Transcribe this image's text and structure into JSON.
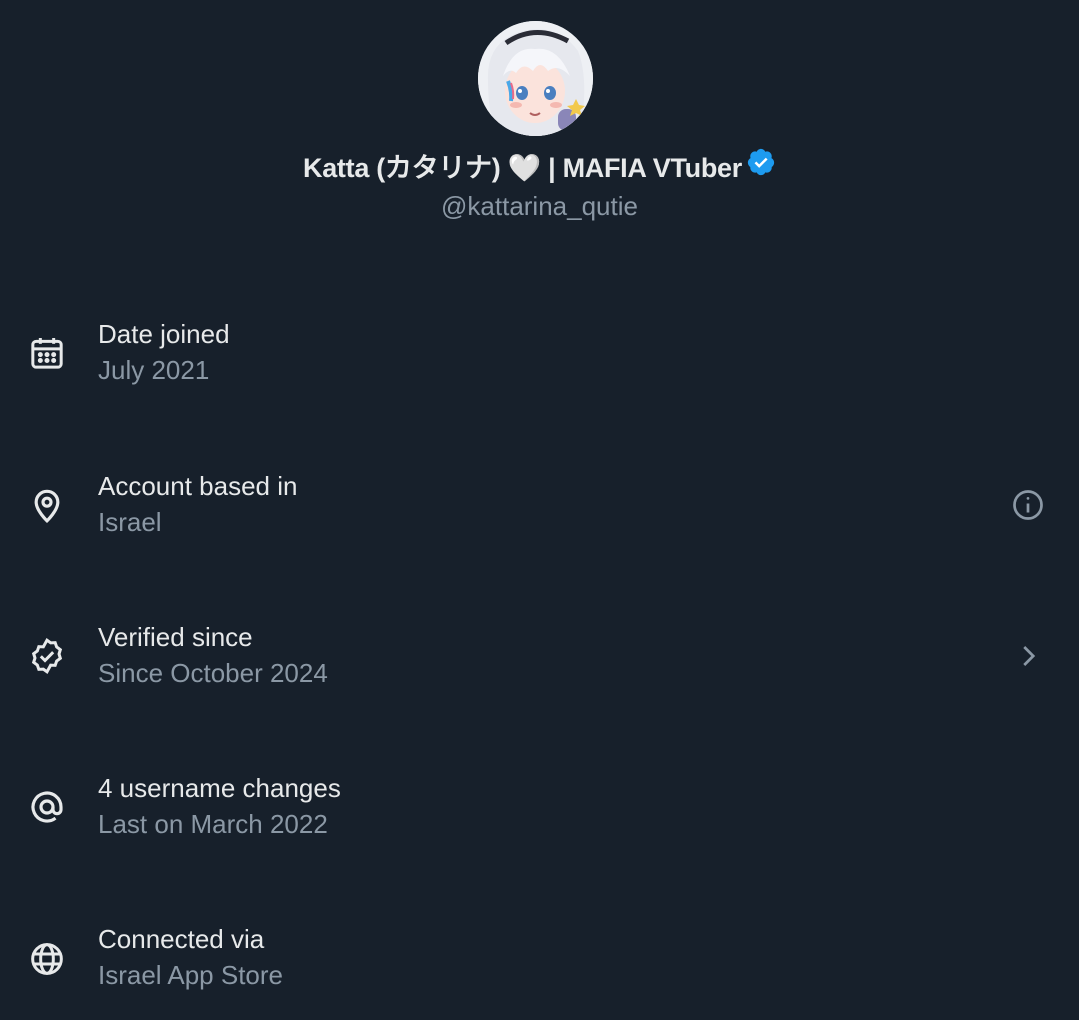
{
  "profile": {
    "display_name": "Katta (カタリナ) 🤍 | MAFIA VTuber",
    "handle": "@kattarina_qutie",
    "verified_icon": "verified-badge-icon",
    "accent_color": "#1d9bf0"
  },
  "about_items": [
    {
      "icon": "calendar-icon",
      "title": "Date joined",
      "value": "July 2021"
    },
    {
      "icon": "location-pin-icon",
      "title": "Account based in",
      "value": "Israel",
      "trailing_icon": "info-icon"
    },
    {
      "icon": "verified-badge-outline-icon",
      "title": "Verified since",
      "value": "Since October 2024",
      "trailing_icon": "chevron-right-icon"
    },
    {
      "icon": "at-sign-icon",
      "title": "4 username changes",
      "value": "Last on March 2022"
    },
    {
      "icon": "globe-icon",
      "title": "Connected via",
      "value": "Israel App Store"
    }
  ],
  "colors": {
    "background": "#17202b",
    "primary_text": "#e7e9ea",
    "secondary_text": "#8b98a5"
  }
}
